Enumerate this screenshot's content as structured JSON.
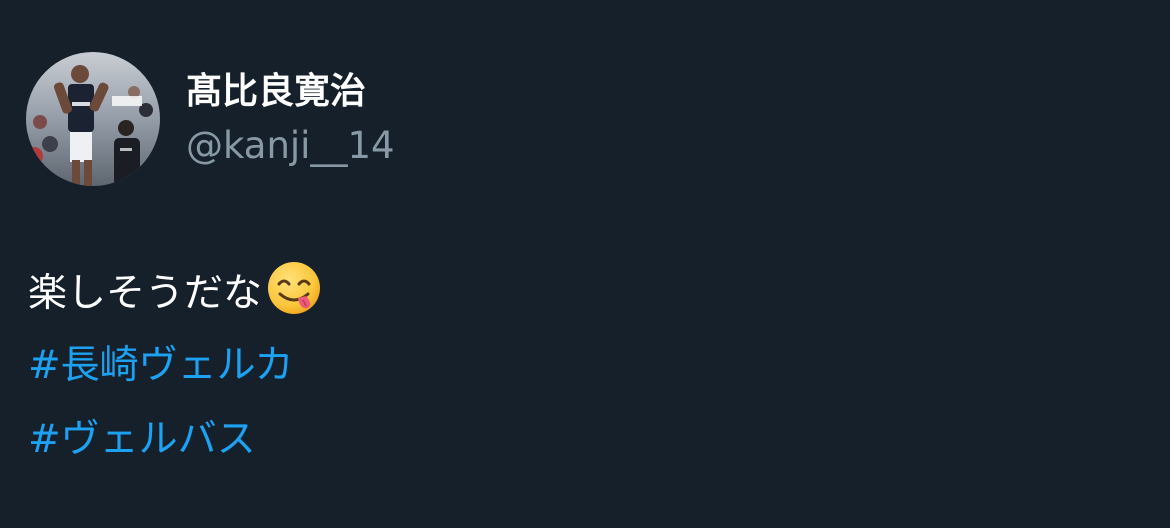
{
  "author": {
    "display_name": "髙比良寛治",
    "handle": "@kanji__14"
  },
  "tweet": {
    "text": "楽しそうだな",
    "emoji": "face-savoring-food-icon",
    "hashtags": [
      "#長崎ヴェルカ",
      "#ヴェルバス"
    ]
  },
  "colors": {
    "background": "#15202b",
    "text_primary": "#ffffff",
    "text_secondary": "#8899a6",
    "link": "#1da1f2"
  }
}
